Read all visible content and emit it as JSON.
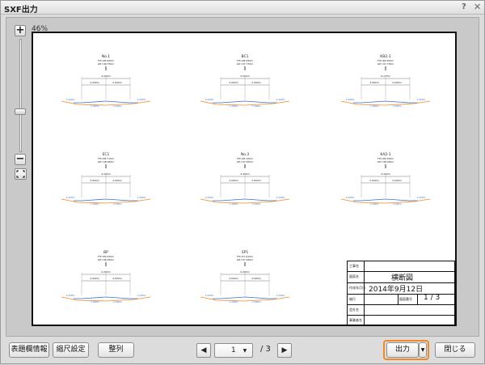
{
  "window": {
    "title": "SXF出力",
    "help_icon": "?",
    "close_icon": "✕"
  },
  "zoom": {
    "level": "46%",
    "plus": "+",
    "minus": "−"
  },
  "sections": [
    {
      "name": "No.1",
      "info1": "FH=48.950m",
      "info2": "GH=48.750m",
      "dim": "4.200m",
      "left": "2.000m",
      "right": "2.000m",
      "s1": "1.500%",
      "s2": "-1.000%",
      "s3": "-1.500%",
      "s4": "1.500%"
    },
    {
      "name": "BC1",
      "info1": "FH=48.950m",
      "info2": "GH=47.733m",
      "dim": "5.500m",
      "left": "3.000m",
      "right": "2.000m",
      "s1": "1.500%",
      "s2": "-1.000%",
      "s3": "-1.500%",
      "s4": "1.500%"
    },
    {
      "name": "KB2-1",
      "info1": "FH=48.950m",
      "info2": "GH=47.730m",
      "dim": "6.275m",
      "left": "3.000m",
      "right": "2.000m",
      "s1": "1.500%",
      "s2": "-1.000%",
      "s3": "-1.500%",
      "s4": "1.500%"
    },
    {
      "name": "EC1",
      "info1": "FH=48.770m",
      "info2": "GH=48.583m",
      "dim": "4.200m",
      "left": "2.000m",
      "right": "2.000m",
      "s1": "1.500%",
      "s2": "-1.000%",
      "s3": "-1.500%",
      "s4": "1.500%"
    },
    {
      "name": "No.3",
      "info1": "FH=48.100m",
      "info2": "GH=47.870m",
      "dim": "4.450m",
      "left": "2.000m",
      "right": "2.000m",
      "s1": "1.500%",
      "s2": "-1.000%",
      "s3": "-1.500%",
      "s4": "1.500%"
    },
    {
      "name": "KA2-1",
      "info1": "FH=48.250m",
      "info2": "GH=48.030m",
      "dim": "4.200m",
      "left": "2.000m",
      "right": "2.000m",
      "s1": "1.500%",
      "s2": "-1.000%",
      "s3": "-1.500%",
      "s4": "1.500%"
    },
    {
      "name": "BP",
      "info1": "FH=48.250m",
      "info2": "GH=48.250m",
      "dim": "4.200m",
      "left": "2.000m",
      "right": "2.000m",
      "s1": "1.500%",
      "s2": "-1.000%",
      "s3": "-1.500%",
      "s4": "1.500%"
    },
    {
      "name": "SP1",
      "info1": "FH=47.910m",
      "info2": "GH=47.250m",
      "dim": "4.200m",
      "left": "2.000m",
      "right": "2.000m",
      "s1": "1.500%",
      "s2": "-1.000%",
      "s3": "-1.500%",
      "s4": "1.500%"
    }
  ],
  "titleblock": {
    "row1_key": "工事名",
    "row2_key": "図面名",
    "drawing_name": "横断図",
    "row3_key": "作成年月日",
    "date": "2014年9月12日",
    "row4_key": "縮尺",
    "sheet_key": "図面番号",
    "sheet_no": "1 / 3",
    "row5_key": "会社名",
    "row6_key": "事業者名"
  },
  "footer": {
    "title_info_btn": "表題欄情報",
    "scale_btn": "縮尺設定",
    "arrange_btn": "整列",
    "prev_icon": "◀",
    "next_icon": "▶",
    "page_current": "1",
    "page_total": "/ 3",
    "output_btn": "出力",
    "output_dropdown": "▼",
    "close_btn": "閉じる"
  },
  "colors": {
    "ground": "#f08a24",
    "road": "#3b6fd0",
    "accent": "#f08a24"
  }
}
